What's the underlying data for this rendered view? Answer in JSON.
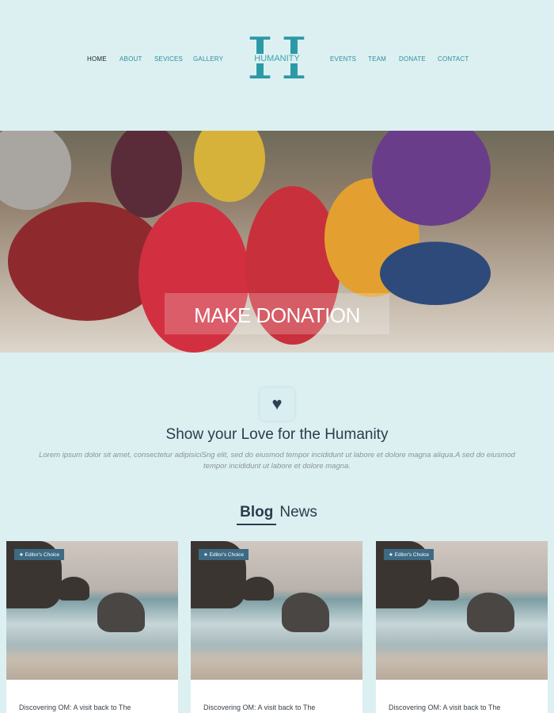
{
  "nav": {
    "left": [
      "HOME",
      "ABOUT",
      "SEVICES",
      "GALLERY"
    ],
    "right": [
      "EVENTS",
      "TEAM",
      "DONATE",
      "CONTACT"
    ]
  },
  "logo": {
    "letter": "H",
    "text": "HUMANITY"
  },
  "hero": {
    "title": "MAKE DONATION"
  },
  "intro": {
    "icon": "heart-icon",
    "heading": "Show your Love for the Humanity",
    "text": "Lorem ipsum dolor sit amet, consectetur adipisiciSng elit, sed do eiusmod tempor incididunt ut labore et dolore magna aliqua.A sed do eiusmod tempor incididunt ut labore et dolore magna."
  },
  "section": {
    "bold": "Blog",
    "rest": "News"
  },
  "cards": [
    {
      "badge": "Editor's Choice",
      "title": "Discovering OM: A visit back to The"
    },
    {
      "badge": "Editor's Choice",
      "title": "Discovering OM: A visit back to The"
    },
    {
      "badge": "Editor's Choice",
      "title": "Discovering OM: A visit back to The"
    }
  ]
}
